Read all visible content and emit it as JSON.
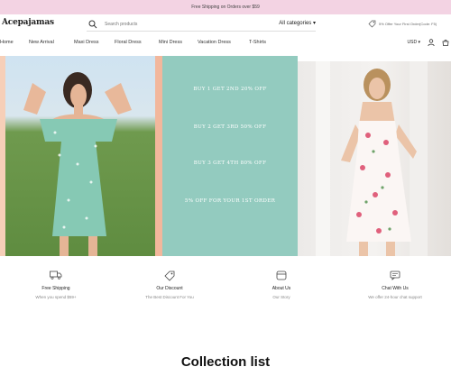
{
  "announcement": "Free Shipping on Orders over $59",
  "header": {
    "logo": "Acepajamas",
    "search_placeholder": "Search products",
    "category_select": "All categories",
    "promo_text": "5% Offer Your First Order(Code: F5)"
  },
  "nav": {
    "items": [
      "Home",
      "New Arrival",
      "Maxi Dress",
      "Floral Dress",
      "Mini Dress",
      "Vacation Dress",
      "T-Shirts"
    ],
    "currency": "USD"
  },
  "hero": {
    "offers": [
      "BUY 1 GET 2ND 20% OFF",
      "BUY 2 GET 3RD 50% OFF",
      "BUY 3 GET 4TH 80% OFF",
      "5% OFF FOR YOUR 1ST ORDER"
    ]
  },
  "features": [
    {
      "icon": "truck-icon",
      "title": "Free Shipping",
      "subtitle": "When you spend $59+"
    },
    {
      "icon": "tag-icon",
      "title": "Our Discount",
      "subtitle": "The Best Discount For You"
    },
    {
      "icon": "store-icon",
      "title": "About Us",
      "subtitle": "Our Story"
    },
    {
      "icon": "chat-icon",
      "title": "Chat With Us",
      "subtitle": "We offer 24-hour chat support"
    }
  ],
  "collection_title": "Collection list",
  "colors": {
    "announce_bg": "#f3d3e3",
    "green_panel": "#93cbbf",
    "orange_strip": "#f2b79c"
  }
}
